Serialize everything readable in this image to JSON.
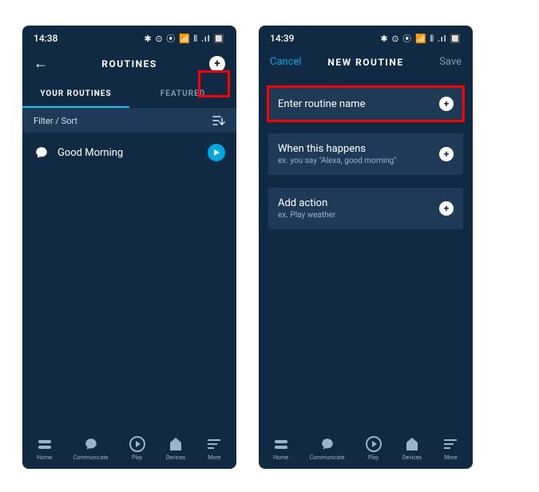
{
  "left": {
    "status": {
      "time": "14:38",
      "icons": "✱ ⊙ ⦿ 📶 ⫴ .ıl 🔲"
    },
    "header": {
      "title": "ROUTINES"
    },
    "tabs": [
      {
        "label": "YOUR ROUTINES",
        "active": true
      },
      {
        "label": "FEATURED",
        "active": false
      }
    ],
    "filter": {
      "label": "Filter / Sort"
    },
    "routines": [
      {
        "name": "Good Morning"
      }
    ],
    "nav": [
      {
        "label": "Home"
      },
      {
        "label": "Communicate"
      },
      {
        "label": "Play"
      },
      {
        "label": "Devices"
      },
      {
        "label": "More"
      }
    ]
  },
  "right": {
    "status": {
      "time": "14:39",
      "icons": "✱ ⊙ ⦿ 📶 ⫴ .ıl 🔲"
    },
    "header": {
      "cancel": "Cancel",
      "title": "NEW ROUTINE",
      "save": "Save"
    },
    "cards": [
      {
        "title": "Enter routine name",
        "sub": "",
        "highlight": true
      },
      {
        "title": "When this happens",
        "sub": "ex. you say \"Alexa, good morning\""
      },
      {
        "title": "Add action",
        "sub": "ex. Play weather"
      }
    ],
    "nav": [
      {
        "label": "Home"
      },
      {
        "label": "Communicate"
      },
      {
        "label": "Play"
      },
      {
        "label": "Devices"
      },
      {
        "label": "More"
      }
    ]
  }
}
